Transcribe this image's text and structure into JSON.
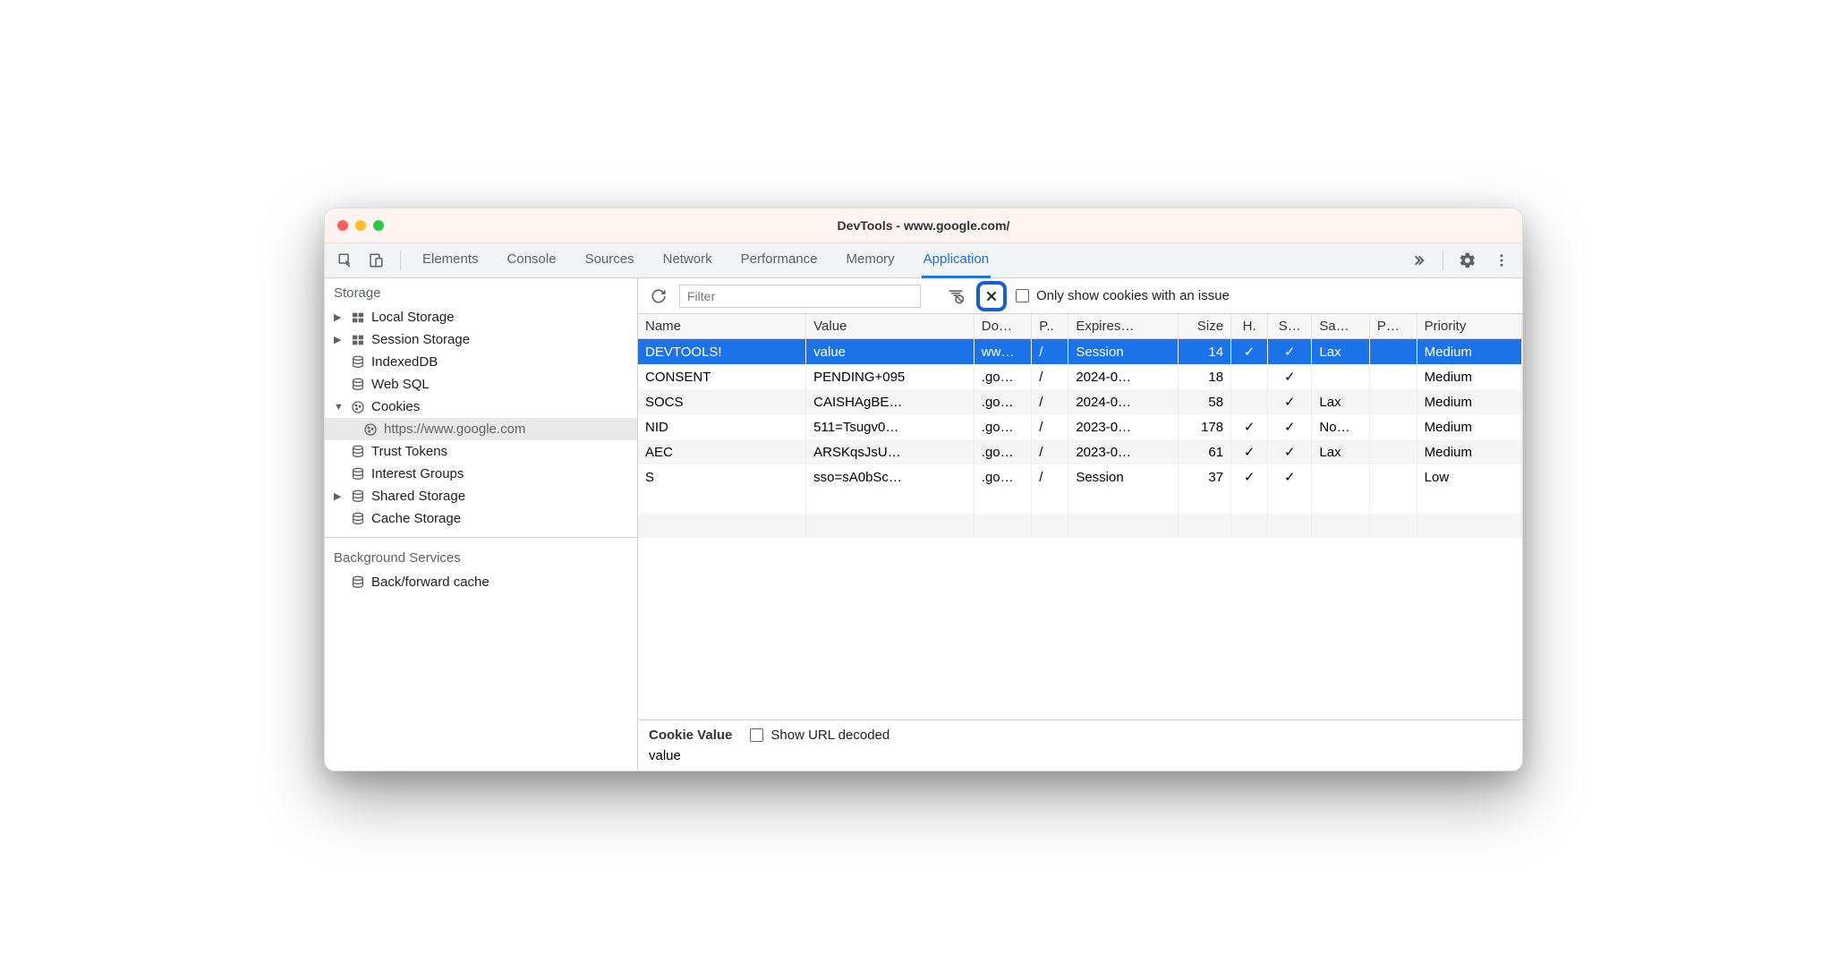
{
  "window": {
    "title": "DevTools - www.google.com/"
  },
  "tabs": {
    "items": [
      "Elements",
      "Console",
      "Sources",
      "Network",
      "Performance",
      "Memory",
      "Application"
    ],
    "active": "Application"
  },
  "sidebar": {
    "section1": "Storage",
    "items": [
      {
        "label": "Local Storage",
        "arrow": "▶",
        "icon": "grid"
      },
      {
        "label": "Session Storage",
        "arrow": "▶",
        "icon": "grid"
      },
      {
        "label": "IndexedDB",
        "arrow": "",
        "icon": "db"
      },
      {
        "label": "Web SQL",
        "arrow": "",
        "icon": "db"
      },
      {
        "label": "Cookies",
        "arrow": "▼",
        "icon": "cookie"
      },
      {
        "label": "https://www.google.com",
        "child": true,
        "icon": "cookie",
        "selected": true
      },
      {
        "label": "Trust Tokens",
        "arrow": "",
        "icon": "db"
      },
      {
        "label": "Interest Groups",
        "arrow": "",
        "icon": "db"
      },
      {
        "label": "Shared Storage",
        "arrow": "▶",
        "icon": "db"
      },
      {
        "label": "Cache Storage",
        "arrow": "",
        "icon": "db"
      }
    ],
    "section2": "Background Services",
    "items2": [
      {
        "label": "Back/forward cache",
        "icon": "db"
      }
    ]
  },
  "filter": {
    "placeholder": "Filter",
    "only_issue_label": "Only show cookies with an issue"
  },
  "columns": [
    "Name",
    "Value",
    "Do…",
    "P..",
    "Expires…",
    "Size",
    "H.",
    "S…",
    "Sa…",
    "P…",
    "Priority"
  ],
  "rows": [
    {
      "name": "DEVTOOLS!",
      "value": "value",
      "domain": "ww…",
      "path": "/",
      "expires": "Session",
      "size": "14",
      "http": "✓",
      "secure": "✓",
      "same": "Lax",
      "pp": "",
      "priority": "Medium",
      "selected": true
    },
    {
      "name": "CONSENT",
      "value": "PENDING+095",
      "domain": ".go…",
      "path": "/",
      "expires": "2024-0…",
      "size": "18",
      "http": "",
      "secure": "✓",
      "same": "",
      "pp": "",
      "priority": "Medium"
    },
    {
      "name": "SOCS",
      "value": "CAISHAgBE…",
      "domain": ".go…",
      "path": "/",
      "expires": "2024-0…",
      "size": "58",
      "http": "",
      "secure": "✓",
      "same": "Lax",
      "pp": "",
      "priority": "Medium"
    },
    {
      "name": "NID",
      "value": "511=Tsugv0…",
      "domain": ".go…",
      "path": "/",
      "expires": "2023-0…",
      "size": "178",
      "http": "✓",
      "secure": "✓",
      "same": "No…",
      "pp": "",
      "priority": "Medium"
    },
    {
      "name": "AEC",
      "value": "ARSKqsJsU…",
      "domain": ".go…",
      "path": "/",
      "expires": "2023-0…",
      "size": "61",
      "http": "✓",
      "secure": "✓",
      "same": "Lax",
      "pp": "",
      "priority": "Medium"
    },
    {
      "name": "S",
      "value": "sso=sA0bSc…",
      "domain": ".go…",
      "path": "/",
      "expires": "Session",
      "size": "37",
      "http": "✓",
      "secure": "✓",
      "same": "",
      "pp": "",
      "priority": "Low"
    }
  ],
  "detail": {
    "title": "Cookie Value",
    "decoded_label": "Show URL decoded",
    "value": "value"
  }
}
